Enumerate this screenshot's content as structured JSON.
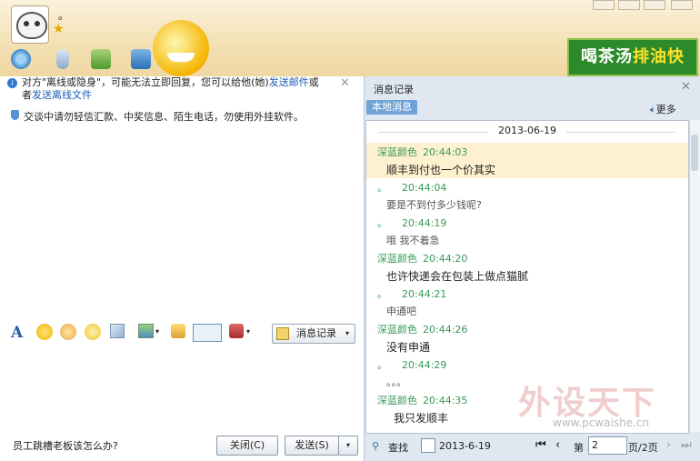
{
  "header": {
    "nickname": "。",
    "ad_text_1": "喝茶汤",
    "ad_text_2": "排油快"
  },
  "left": {
    "notice_prefix": "对方\"离线或隐身\"，可能无法立即回复，您可以给他(她)",
    "notice_link1": "发送邮件",
    "notice_mid": "或者",
    "notice_link2": "发送离线文件",
    "warning": "交谈中请勿轻信汇款、中奖信息、陌生电话，勿使用外挂软件。",
    "msg_record_btn": "消息记录",
    "bottom_question": "员工跳槽老板该怎么办?",
    "close_btn": "关闭(C)",
    "send_btn": "发送(S)"
  },
  "right": {
    "title": "消息记录",
    "tab_local": "本地消息",
    "more": "更多",
    "date": "2013-06-19",
    "messages": [
      {
        "sender": "深蓝颜色",
        "time": "20:44:03",
        "text": "顺丰到付也一个价其实"
      },
      {
        "sender": "。",
        "time": "20:44:04",
        "text": "要是不到付多少钱呢?"
      },
      {
        "sender": "。",
        "time": "20:44:19",
        "text": "哦  我不着急"
      },
      {
        "sender": "深蓝颜色",
        "time": "20:44:20",
        "text": "也许快递会在包装上做点猫腻"
      },
      {
        "sender": "。",
        "time": "20:44:21",
        "text": "申通吧"
      },
      {
        "sender": "深蓝颜色",
        "time": "20:44:26",
        "text": "没有申通"
      },
      {
        "sender": "。",
        "time": "20:44:29",
        "text": "。。。"
      },
      {
        "sender": "深蓝颜色",
        "time": "20:44:35",
        "text": "我只发顺丰"
      }
    ],
    "find": "查找",
    "date_field": "2013-6-19",
    "page_label": "第",
    "page_value": "2",
    "page_total": "页/2页"
  },
  "watermark": {
    "brand": "外设天下",
    "url": "www.pcwaishe.cn"
  },
  "colors": {
    "accent": "#2f7bd1",
    "sender_green": "#3a9a5a",
    "highlight": "#fdf1cf"
  }
}
